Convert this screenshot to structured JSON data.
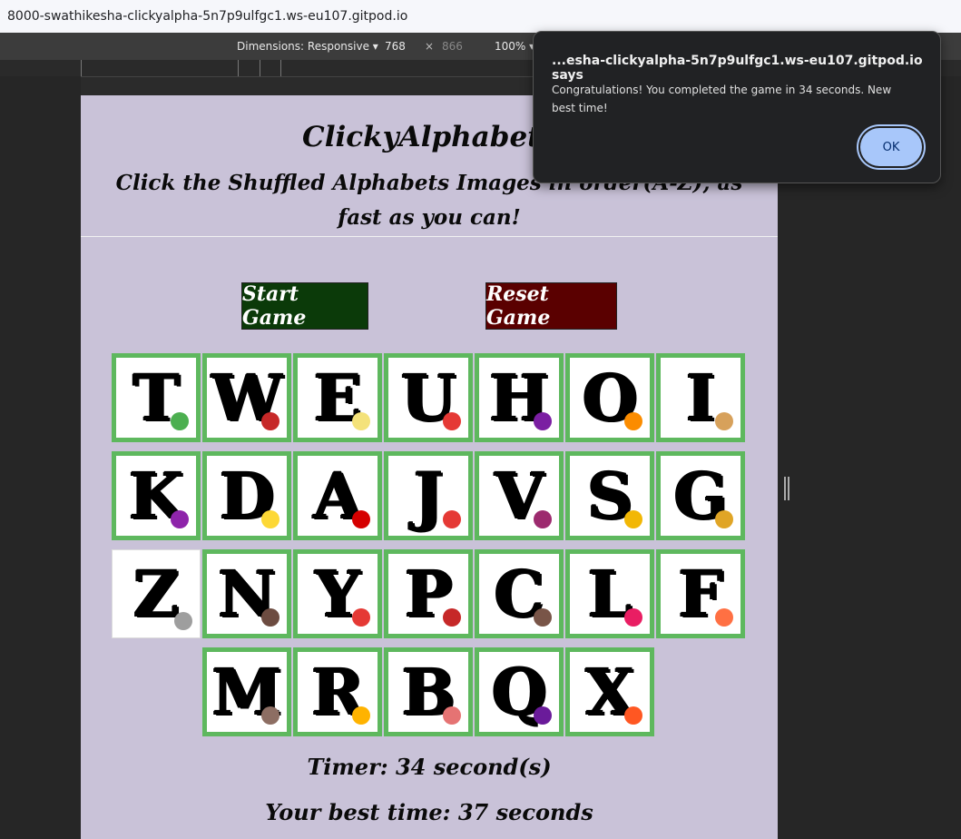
{
  "browser": {
    "url": "8000-swathikesha-clickyalpha-5n7p9ulfgc1.ws-eu107.gitpod.io",
    "devtools": {
      "dimensions_label": "Dimensions: Responsive ▾",
      "width": "768",
      "times": "×",
      "height": "866",
      "zoom": "100% ▾"
    }
  },
  "page": {
    "title": "ClickyAlphabets",
    "subtitle": "Click the Shuffled Alphabets Images in order(A-Z), as fast as you can!",
    "start_button": "Start Game",
    "reset_button": "Reset Game",
    "tile_rows": [
      [
        {
          "letter": "T",
          "deco": "#4caf50"
        },
        {
          "letter": "W",
          "deco": "#c62828"
        },
        {
          "letter": "E",
          "deco": "#f4e27a"
        },
        {
          "letter": "U",
          "deco": "#e53935"
        },
        {
          "letter": "H",
          "deco": "#7b1fa2"
        },
        {
          "letter": "O",
          "deco": "#fb8c00"
        },
        {
          "letter": "I",
          "deco": "#d7a15b"
        }
      ],
      [
        {
          "letter": "K",
          "deco": "#8e24aa"
        },
        {
          "letter": "D",
          "deco": "#fdd835"
        },
        {
          "letter": "A",
          "deco": "#d50000"
        },
        {
          "letter": "J",
          "deco": "#e53935"
        },
        {
          "letter": "V",
          "deco": "#9c2a6e"
        },
        {
          "letter": "S",
          "deco": "#f2b705"
        },
        {
          "letter": "G",
          "deco": "#e0a526"
        }
      ],
      [
        {
          "letter": "Z",
          "deco": "#9e9e9e",
          "done": true
        },
        {
          "letter": "N",
          "deco": "#6d4c41"
        },
        {
          "letter": "Y",
          "deco": "#e53935"
        },
        {
          "letter": "P",
          "deco": "#c62828"
        },
        {
          "letter": "C",
          "deco": "#795548"
        },
        {
          "letter": "L",
          "deco": "#e91e63"
        },
        {
          "letter": "F",
          "deco": "#ff7043"
        }
      ],
      [
        {
          "letter": "M",
          "deco": "#8d6e63"
        },
        {
          "letter": "R",
          "deco": "#ffb300"
        },
        {
          "letter": "B",
          "deco": "#e57373"
        },
        {
          "letter": "Q",
          "deco": "#6a1b9a"
        },
        {
          "letter": "X",
          "deco": "#ff5722"
        }
      ]
    ],
    "timer_text": "Timer: 34 second(s)",
    "best_text": "Your best time: 37 seconds"
  },
  "dialog": {
    "title": "...esha-clickyalpha-5n7p9ulfgc1.ws-eu107.gitpod.io says",
    "message": "Congratulations! You completed the game in 34 seconds. New best time!",
    "ok_label": "OK"
  }
}
